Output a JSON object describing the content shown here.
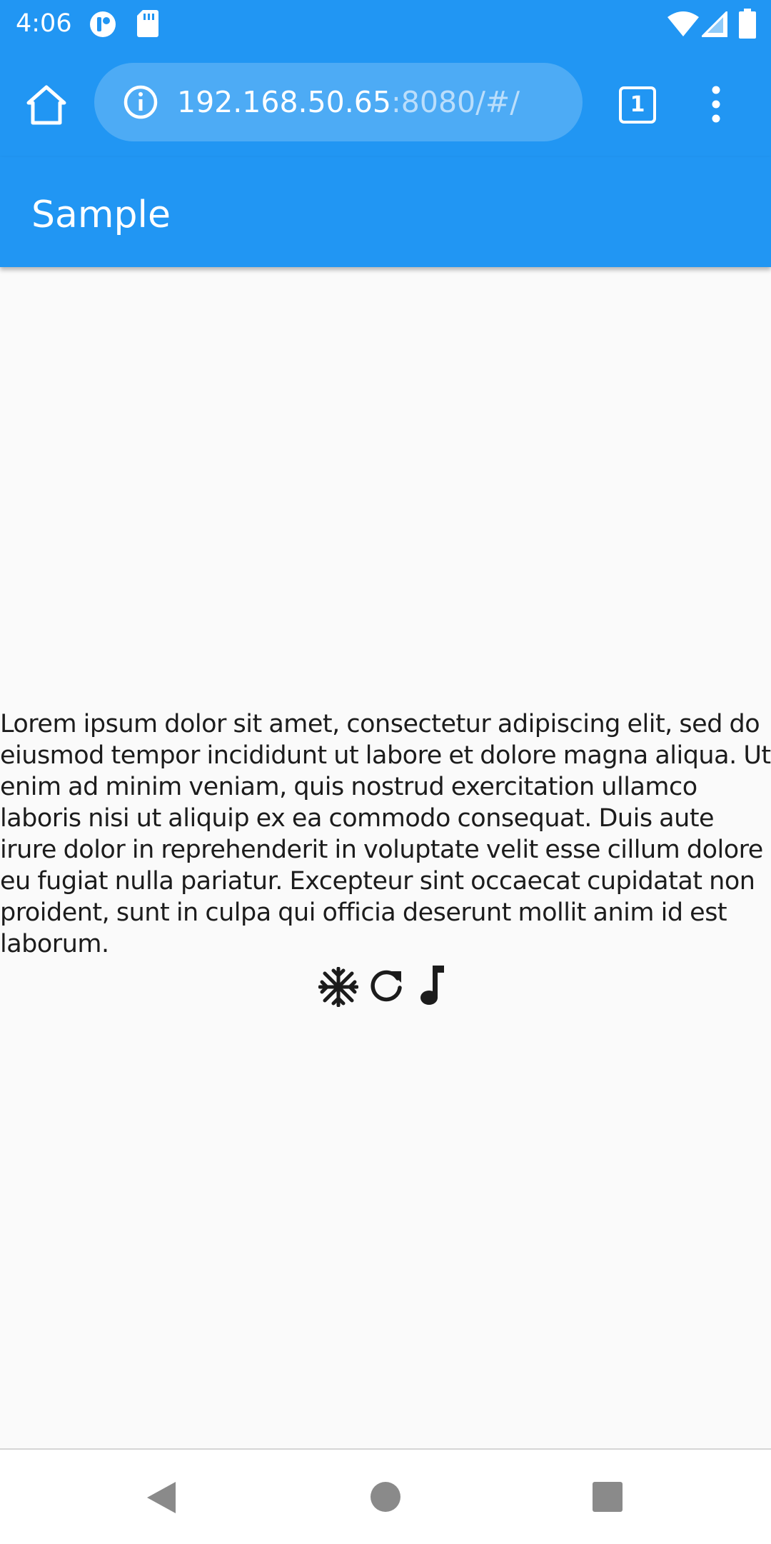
{
  "status_bar": {
    "time": "4:06",
    "left_icons": [
      "app-notification-icon",
      "sd-card-icon"
    ],
    "right_icons": [
      "wifi-icon",
      "cell-signal-icon",
      "battery-icon"
    ]
  },
  "browser": {
    "url_host": "192.168.50.65",
    "url_rest": ":8080/#/",
    "tab_count": "1"
  },
  "app_bar": {
    "title": "Sample"
  },
  "main": {
    "paragraph": "Lorem ipsum dolor sit amet, consectetur adipiscing elit, sed do eiusmod tempor incididunt ut labore et dolore magna aliqua. Ut enim ad minim veniam, quis nostrud exercitation ullamco laboris nisi ut aliquip ex ea commodo consequat. Duis aute irure dolor in reprehenderit in voluptate velit esse cillum dolore eu fugiat nulla pariatur. Excepteur sint occaecat cupidatat non proident, sunt in culpa qui officia deserunt mollit anim id est laborum.",
    "icons": [
      "snowflake-icon",
      "refresh-icon",
      "music-note-icon"
    ]
  },
  "nav_bar": {
    "buttons": [
      "back-button",
      "home-button",
      "recents-button"
    ]
  },
  "colors": {
    "primary": "#2196f3",
    "url_pill": "#4dabf5",
    "background": "#fafafa",
    "text": "#1c1c1c"
  }
}
